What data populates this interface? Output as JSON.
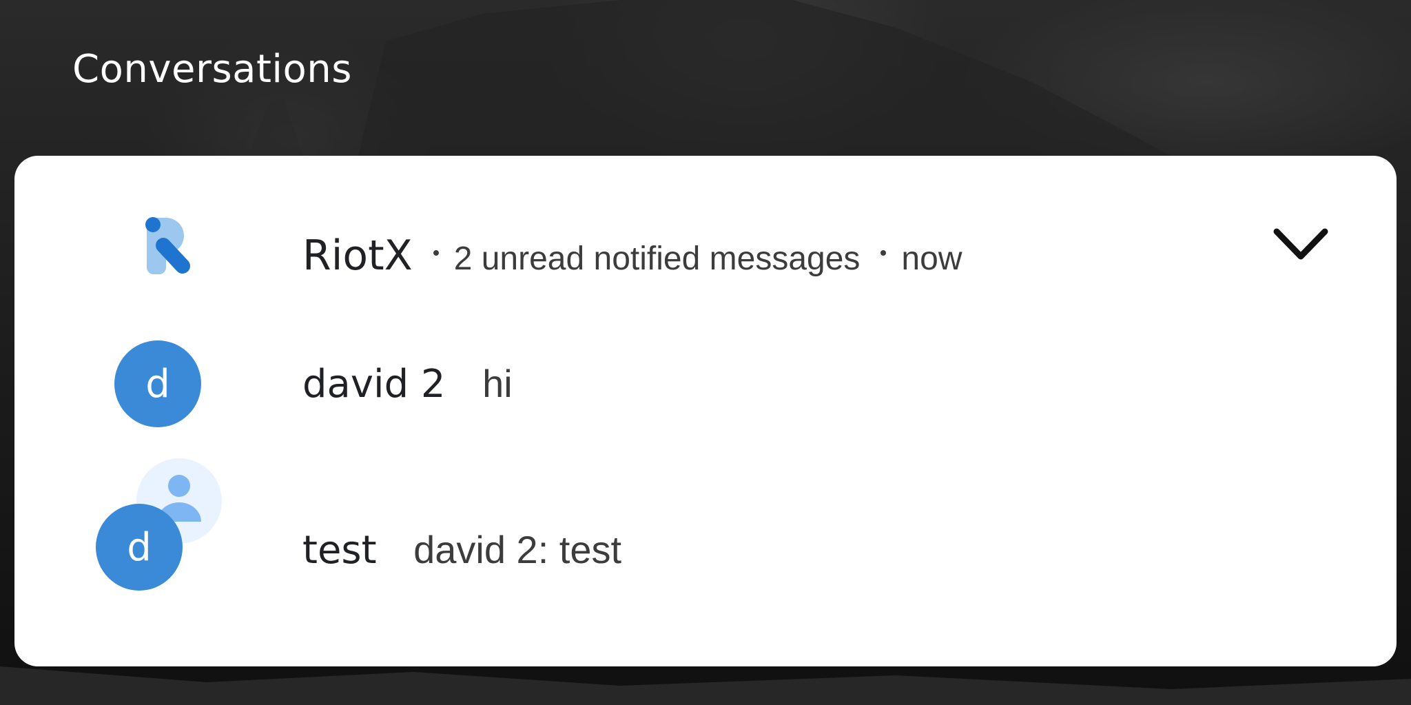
{
  "section": {
    "title": "Conversations"
  },
  "notification": {
    "app_name": "RiotX",
    "summary": "2 unread notified messages",
    "time": "now",
    "icons": {
      "app": "riotx-logo-icon",
      "expand": "chevron-down-icon",
      "group": "group-icon"
    },
    "colors": {
      "avatar": "#3b8ad8",
      "logo_light": "#9cc7ee",
      "logo_dark": "#1f74cf",
      "card": "#ffffff"
    },
    "messages": [
      {
        "avatar_letter": "d",
        "sender": "david 2",
        "text": "hi"
      },
      {
        "avatar_letter": "d",
        "sender": "test",
        "text": "david 2: test"
      }
    ]
  }
}
